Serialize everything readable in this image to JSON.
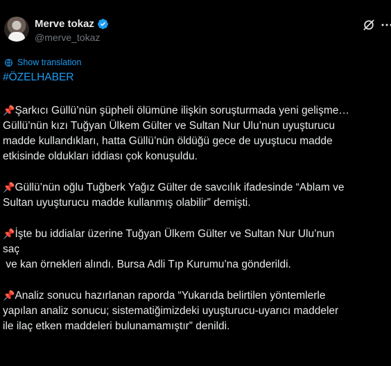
{
  "author": {
    "name": "Merve tokaz",
    "handle": "@merve_tokaz"
  },
  "icons": {
    "verified": "verified-badge-icon",
    "grok": "grok-icon",
    "more": "more-icon",
    "translate": "translate-globe-icon",
    "pin": "pushpin-emoji"
  },
  "colors": {
    "accent": "#1d9bf0",
    "text": "#e7e9ea",
    "muted": "#71767b",
    "background": "#000000"
  },
  "translation_label": "Show translation",
  "hashtag": "#ÖZELHABER",
  "paragraphs": [
    "Şarkıcı Güllü’nün şüpheli ölümüne ilişkin soruşturmada yeni gelişme…\nGüllü’nün kızı Tuğyan Ülkem Gülter ve Sultan Nur Ulu’nun uyuşturucu\nmadde kullandıkları, hatta Güllü’nün öldüğü gece de uyuştucu madde\netkisinde oldukları iddiası çok konuşuldu.",
    "Güllü’nün oğlu Tuğberk Yağız Gülter de savcılık ifadesinde “Ablam ve\nSultan uyuşturucu madde kullanmış olabilir” demişti.",
    "İşte bu iddialar üzerine Tuğyan Ülkem Gülter ve Sultan Nur Ulu’nun\nsaç\n ve kan örnekleri alındı. Bursa Adli Tıp Kurumu’na gönderildi.",
    "Analiz sonucu hazırlanan raporda “Yukarıda belirtilen yöntemlerle\nyapılan analiz sonucu; sistematiğimizdeki uyuşturucu-uyarıcı maddeler\nile ilaç etken maddeleri bulunamamıştır” denildi."
  ]
}
